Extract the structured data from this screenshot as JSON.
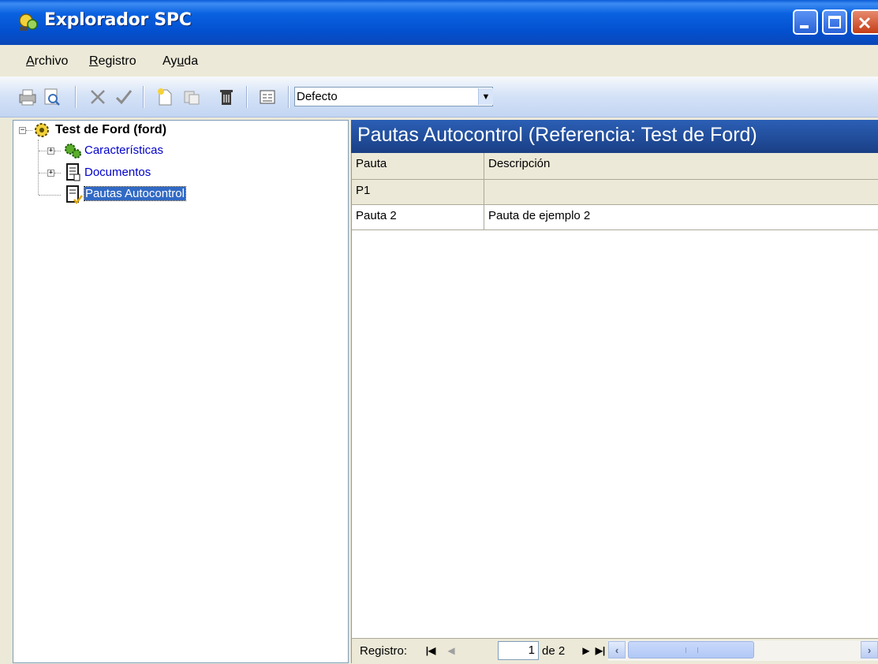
{
  "window": {
    "title": "Explorador SPC"
  },
  "menu": {
    "items": [
      "Archivo",
      "Registro",
      "Ayuda"
    ]
  },
  "toolbar": {
    "icons": [
      "printer-icon",
      "print-preview-icon",
      "cancel-icon",
      "accept-icon",
      "new-icon",
      "copy-icon",
      "delete-icon",
      "form-view-icon"
    ],
    "combo_value": "Defecto"
  },
  "tree": {
    "root": {
      "label": "Test de Ford (ford)",
      "icon": "gear-cluster-icon"
    },
    "children": [
      {
        "label": "Características",
        "icon": "gears-icon"
      },
      {
        "label": "Documentos",
        "icon": "document-icon"
      },
      {
        "label": "Pautas Autocontrol",
        "icon": "checklist-icon"
      }
    ]
  },
  "panel": {
    "title": "Pautas Autocontrol (Referencia: Test de Ford)",
    "columns": [
      "Pauta",
      "Descripción"
    ],
    "rows": [
      [
        "P1",
        ""
      ],
      [
        "Pauta 2",
        "Pauta de ejemplo 2"
      ]
    ]
  },
  "navigator": {
    "label": "Registro:",
    "position": "1",
    "total": "de 2"
  },
  "colors": {
    "title_bar": "#0A5CD8",
    "panel_header": "#1F4C98",
    "selection": "#316AC5",
    "link": "#0000CC"
  }
}
